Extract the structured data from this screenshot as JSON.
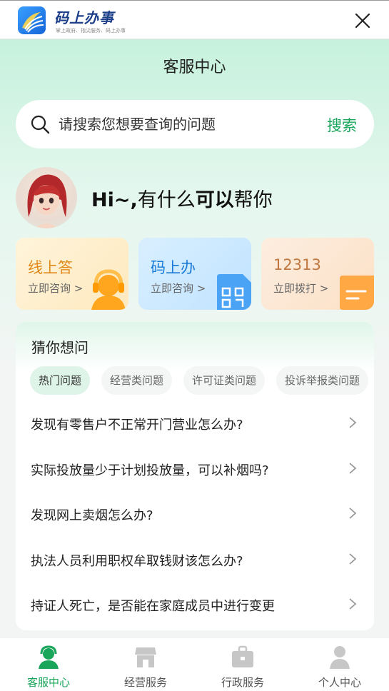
{
  "app": {
    "name": "码上办事",
    "slogan": "掌上政府、指尖服务、码上办事"
  },
  "page": {
    "title": "客服中心"
  },
  "search": {
    "placeholder": "请搜索您想要查询的问题",
    "button_label": "搜索"
  },
  "greeting": {
    "prefix": "Hi~,",
    "middle": "有什么",
    "bold": "可以",
    "suffix": "帮你"
  },
  "cards": [
    {
      "title": "线上答",
      "subtitle": "立即咨询",
      "icon": "headset-agent-icon"
    },
    {
      "title": "码上办",
      "subtitle": "立即咨询",
      "icon": "qr-code-icon"
    },
    {
      "title": "12313",
      "subtitle": "立即拨打",
      "icon": "notepad-icon"
    }
  ],
  "faq": {
    "title": "猜你想问",
    "tabs": [
      "热门问题",
      "经营类问题",
      "许可证类问题",
      "投诉举报类问题"
    ],
    "active_tab": "热门问题",
    "questions": [
      "发现有零售户不正常开门营业怎么办?",
      "实际投放量少于计划投放量，可以补烟吗?",
      "发现网上卖烟怎么办?",
      "执法人员利用职权牟取钱财该怎么办?",
      "持证人死亡，是否能在家庭成员中进行变更"
    ]
  },
  "tabbar": {
    "active": "客服中心",
    "items": [
      {
        "label": "客服中心",
        "icon": "customer-service-icon"
      },
      {
        "label": "经营服务",
        "icon": "store-icon"
      },
      {
        "label": "行政服务",
        "icon": "briefcase-icon"
      },
      {
        "label": "个人中心",
        "icon": "person-icon"
      }
    ]
  },
  "colors": {
    "accent_green": "#19a55a",
    "card1_title": "#e18a1b",
    "card2_title": "#1c7bd6",
    "card3_title": "#c07840"
  }
}
